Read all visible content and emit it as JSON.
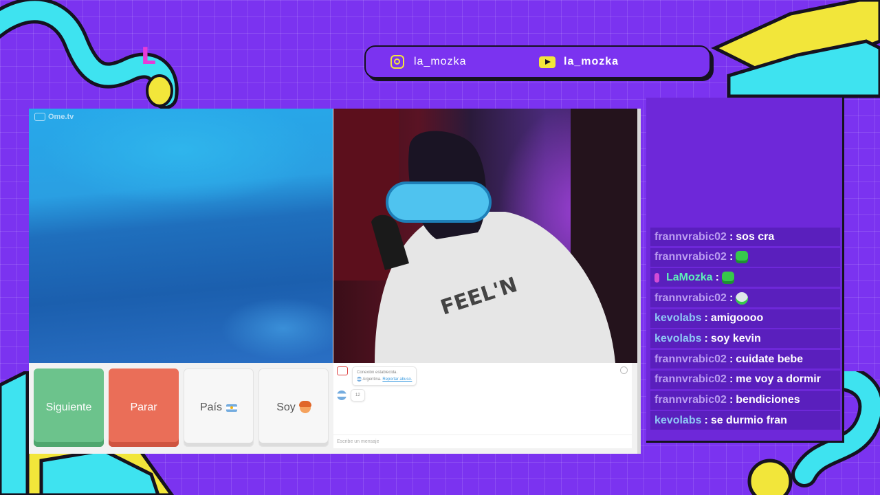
{
  "overlay": {
    "logo_letter": "L",
    "social": [
      {
        "icon": "instagram-icon",
        "handle": "la_mozka"
      },
      {
        "icon": "youtube-icon",
        "handle": "la_mozka"
      }
    ],
    "colors": {
      "background": "#7b33f0",
      "accent_yellow": "#f2e63a",
      "accent_cyan": "#3ee3f0",
      "dark": "#15121f"
    }
  },
  "ometv": {
    "logo": "Ome.tv",
    "buttons": {
      "next": "Siguiente",
      "stop": "Parar",
      "country": "País",
      "me": "Soy"
    },
    "chat": {
      "system_line1": "Conexión establecida.",
      "system_country": "Argentina.",
      "system_link": "Reportar abuso.",
      "user_message": "12",
      "input_placeholder": "Escribe un mensaje"
    }
  },
  "stream_chat": {
    "messages": [
      {
        "user": "frannvrabic02",
        "text": "sos cra",
        "emote": ""
      },
      {
        "user": "frannvrabic02",
        "text": "",
        "emote": "green-emote"
      },
      {
        "user": "LaMozka",
        "text": "",
        "emote": "green-emote",
        "badge": "mic-badge"
      },
      {
        "user": "frannvrabic02",
        "text": "",
        "emote": "skull-emote"
      },
      {
        "user": "kevolabs",
        "text": "amigoooo",
        "emote": ""
      },
      {
        "user": "kevolabs",
        "text": "soy kevin",
        "emote": ""
      },
      {
        "user": "frannvrabic02",
        "text": "cuidate bebe",
        "emote": ""
      },
      {
        "user": "frannvrabic02",
        "text": "me voy a dormir",
        "emote": ""
      },
      {
        "user": "frannvrabic02",
        "text": "bendiciones",
        "emote": ""
      },
      {
        "user": "kevolabs",
        "text": "se durmio fran",
        "emote": ""
      }
    ]
  }
}
